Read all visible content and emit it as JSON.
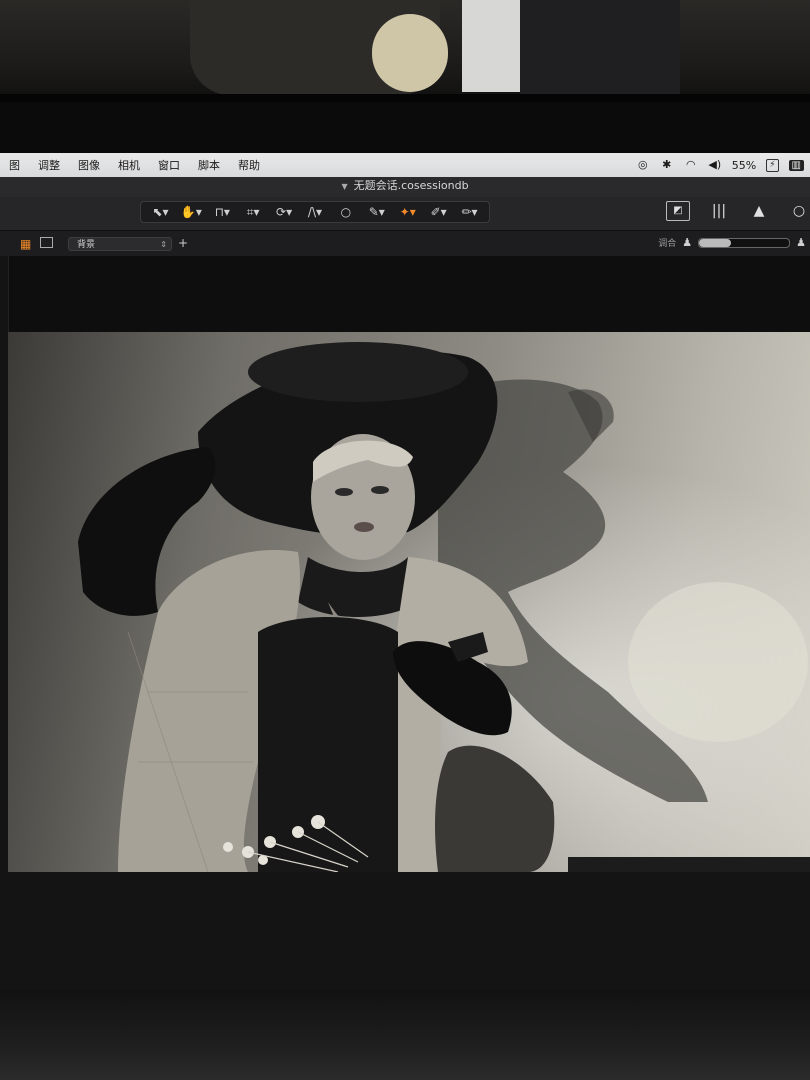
{
  "menubar": {
    "items": [
      "图",
      "调整",
      "图像",
      "相机",
      "窗口",
      "脚本",
      "帮助"
    ],
    "battery_percent": "55%",
    "status_icons": [
      "display-icon",
      "bluetooth-icon",
      "wifi-icon",
      "volume-icon",
      "battery-icon",
      "app-icon"
    ]
  },
  "window": {
    "title": "无题会话.cosessiondb"
  },
  "toolbar": {
    "tools": [
      "select-icon",
      "hand-icon",
      "stamp-icon",
      "crop-icon",
      "rotate-icon",
      "keystone-icon",
      "circle-icon",
      "eyedropper-icon",
      "pin-icon",
      "brush-icon",
      "pencil-icon"
    ],
    "active_tool": "pin-icon",
    "right_icons": [
      "compare-icon",
      "histogram-icon",
      "warning-icon",
      "more-icon"
    ]
  },
  "layerbar": {
    "layer_name": "背景",
    "right_label": "调合",
    "slider_level_fraction": 0.35
  },
  "photo": {
    "description_icon": "portrait-photo"
  },
  "colors": {
    "accent": "#f08a2a",
    "chrome": "#262628",
    "menubar": "#e3e3e4"
  }
}
